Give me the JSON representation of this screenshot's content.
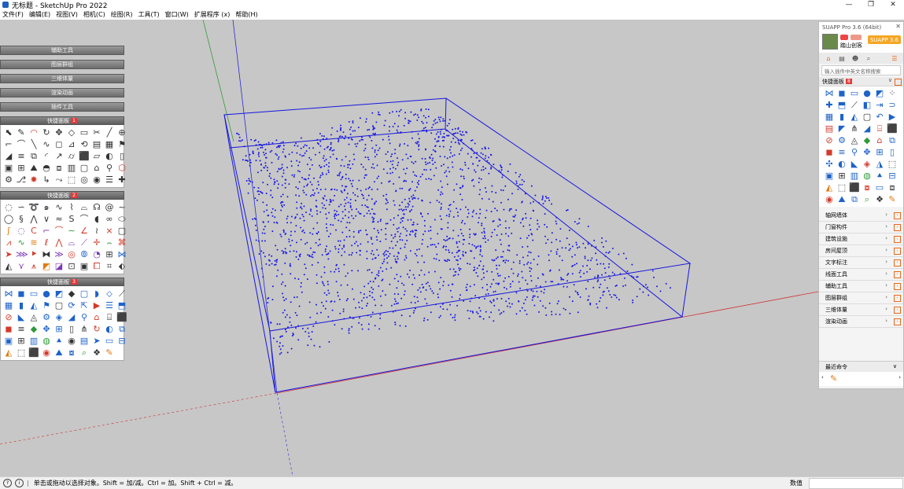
{
  "window": {
    "title": "无标题 - SketchUp Pro 2022",
    "controls": [
      "—",
      "❐",
      "✕"
    ]
  },
  "menu": [
    "文件(F)",
    "编辑(E)",
    "视图(V)",
    "相机(C)",
    "绘图(R)",
    "工具(T)",
    "窗口(W)",
    "扩展程序 (x)",
    "帮助(H)"
  ],
  "left_panel": {
    "buttons": [
      "辅助工具",
      "图层群组",
      "三维体量",
      "渲染动画",
      "插件工具"
    ],
    "toolbar1": {
      "title": "快捷面板",
      "badge": "1"
    },
    "toolbar2": {
      "title": "快捷面板",
      "badge": "2"
    },
    "toolbar3": {
      "title": "快捷面板",
      "badge": "3"
    }
  },
  "suapp": {
    "title": "SUAPP Pro 3.6 (64bit)",
    "close": "✕",
    "user": "踏山创客",
    "button": "SUAPP 3.6",
    "search_placeholder": "输入插件中英文名称搜索",
    "quick_panel": {
      "label": "快捷面板",
      "badge": "8"
    },
    "categories": [
      "轴网墙体",
      "门窗构件",
      "建筑设施",
      "房间屋顶",
      "文字标注",
      "线面工具",
      "辅助工具",
      "图层群组",
      "三维体量",
      "渲染动画"
    ],
    "recent": {
      "label": "最近命令"
    }
  },
  "status": {
    "message": "单击或拖动以选择对象。Shift = 加/减。Ctrl = 加。Shift + Ctrl = 减。",
    "value_label": "数值",
    "value": ""
  }
}
